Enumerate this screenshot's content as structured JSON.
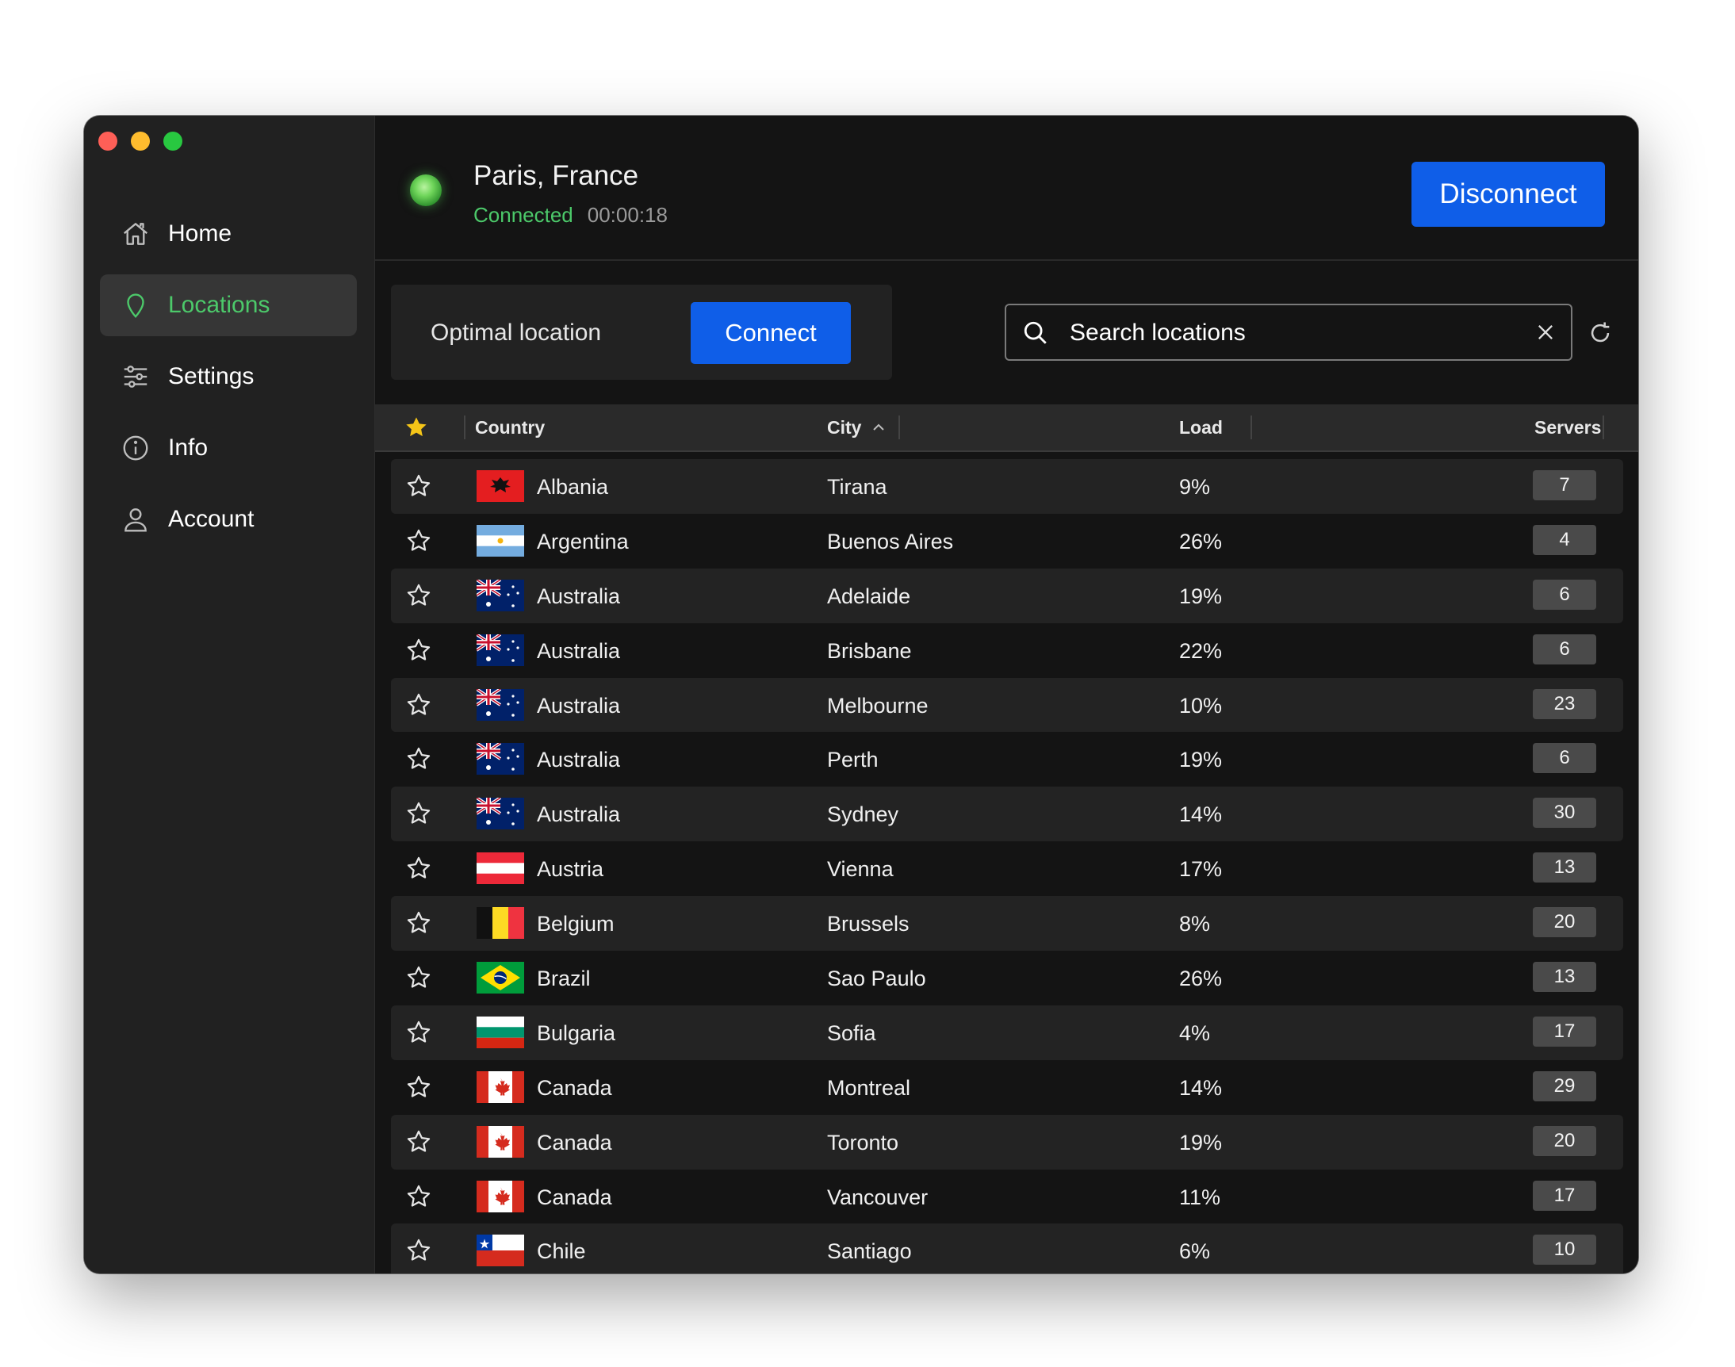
{
  "sidebar": {
    "items": [
      {
        "label": "Home",
        "icon": "home-icon",
        "active": false
      },
      {
        "label": "Locations",
        "icon": "map-pin-icon",
        "active": true
      },
      {
        "label": "Settings",
        "icon": "sliders-icon",
        "active": false
      },
      {
        "label": "Info",
        "icon": "info-icon",
        "active": false
      },
      {
        "label": "Account",
        "icon": "user-icon",
        "active": false
      }
    ]
  },
  "header": {
    "location": "Paris, France",
    "status": "Connected",
    "elapsed": "00:00:18",
    "disconnect_label": "Disconnect"
  },
  "toolbar": {
    "optimal_label": "Optimal location",
    "connect_label": "Connect",
    "search_placeholder": "Search locations"
  },
  "table": {
    "columns": {
      "country": "Country",
      "city": "City",
      "load": "Load",
      "servers": "Servers"
    },
    "rows": [
      {
        "country": "Albania",
        "city": "Tirana",
        "load": "9%",
        "servers": "7",
        "flag": "AL"
      },
      {
        "country": "Argentina",
        "city": "Buenos Aires",
        "load": "26%",
        "servers": "4",
        "flag": "AR"
      },
      {
        "country": "Australia",
        "city": "Adelaide",
        "load": "19%",
        "servers": "6",
        "flag": "AU"
      },
      {
        "country": "Australia",
        "city": "Brisbane",
        "load": "22%",
        "servers": "6",
        "flag": "AU"
      },
      {
        "country": "Australia",
        "city": "Melbourne",
        "load": "10%",
        "servers": "23",
        "flag": "AU"
      },
      {
        "country": "Australia",
        "city": "Perth",
        "load": "19%",
        "servers": "6",
        "flag": "AU"
      },
      {
        "country": "Australia",
        "city": "Sydney",
        "load": "14%",
        "servers": "30",
        "flag": "AU"
      },
      {
        "country": "Austria",
        "city": "Vienna",
        "load": "17%",
        "servers": "13",
        "flag": "AT"
      },
      {
        "country": "Belgium",
        "city": "Brussels",
        "load": "8%",
        "servers": "20",
        "flag": "BE"
      },
      {
        "country": "Brazil",
        "city": "Sao Paulo",
        "load": "26%",
        "servers": "13",
        "flag": "BR"
      },
      {
        "country": "Bulgaria",
        "city": "Sofia",
        "load": "4%",
        "servers": "17",
        "flag": "BG"
      },
      {
        "country": "Canada",
        "city": "Montreal",
        "load": "14%",
        "servers": "29",
        "flag": "CA"
      },
      {
        "country": "Canada",
        "city": "Toronto",
        "load": "19%",
        "servers": "20",
        "flag": "CA"
      },
      {
        "country": "Canada",
        "city": "Vancouver",
        "load": "11%",
        "servers": "17",
        "flag": "CA"
      },
      {
        "country": "Chile",
        "city": "Santiago",
        "load": "6%",
        "servers": "10",
        "flag": "CL"
      }
    ]
  },
  "colors": {
    "accent": "#0f5ee8",
    "connected": "#4cc96a"
  }
}
